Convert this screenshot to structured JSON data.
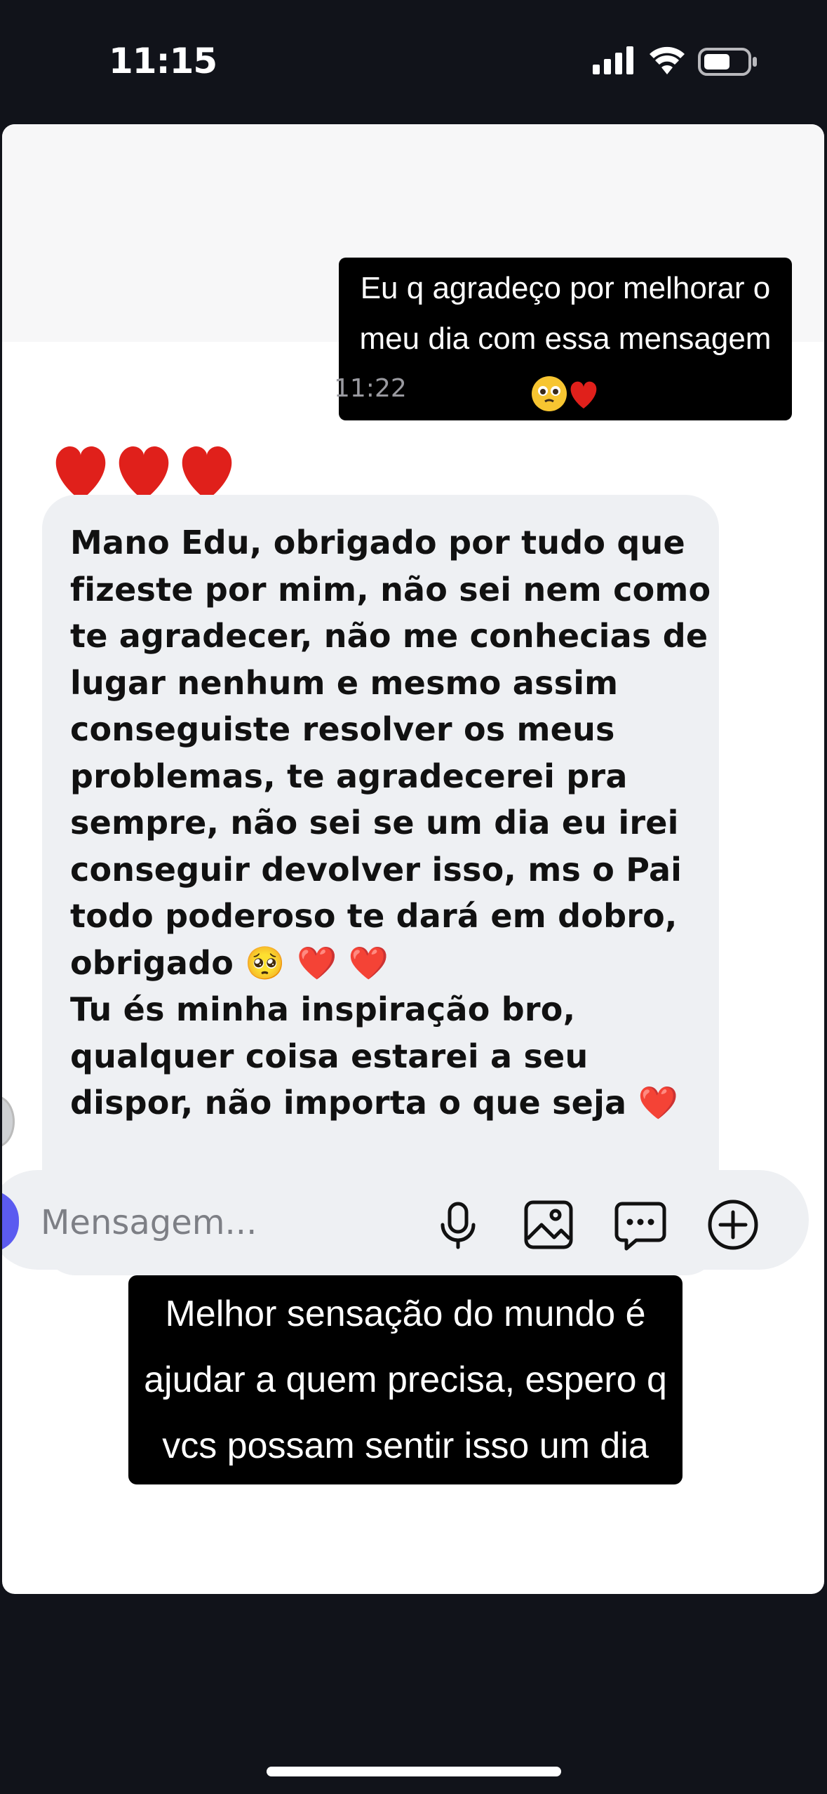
{
  "status_bar": {
    "time": "11:15",
    "icons": [
      "cellular-signal-icon",
      "wifi-icon",
      "battery-icon"
    ]
  },
  "chat": {
    "sent_caption_lines": [
      "Eu q agradeço por melhorar o",
      "meu dia com essa mensagem 😭"
    ],
    "sent_emoji": "🥺❤️",
    "timestamp": "11:22",
    "reaction_hearts": "❤️❤️❤️",
    "received_lines": [
      "Mano Edu, obrigado por tudo que",
      "fizeste por mim, não sei nem como",
      "te agradecer, não me conhecias de",
      "lugar nenhum e mesmo assim",
      "conseguiste resolver os meus",
      "problemas, te agradecerei pra",
      "sempre, não sei se um dia eu irei",
      "conseguir devolver isso, ms o Pai",
      "todo poderoso te dará em dobro,",
      "obrigado 🥺 ❤️ ❤️",
      "Tu és minha inspiração bro,",
      "qualquer coisa estarei a seu",
      "dispor, não importa o que seja ❤️"
    ]
  },
  "composer": {
    "placeholder": "Mensagem...",
    "icons": [
      "microphone-icon",
      "image-icon",
      "sticker-icon",
      "add-icon"
    ]
  },
  "overlay_caption_lines": [
    "Melhor sensação do mundo é",
    "ajudar a quem precisa, espero q",
    "vcs possam sentir isso um dia"
  ],
  "colors": {
    "background": "#11131a",
    "card": "#ffffff",
    "bubble": "#eef0f3",
    "caption_bg": "#000000",
    "heart": "#e0201b",
    "avatar_accent": "#5b5bf0"
  }
}
